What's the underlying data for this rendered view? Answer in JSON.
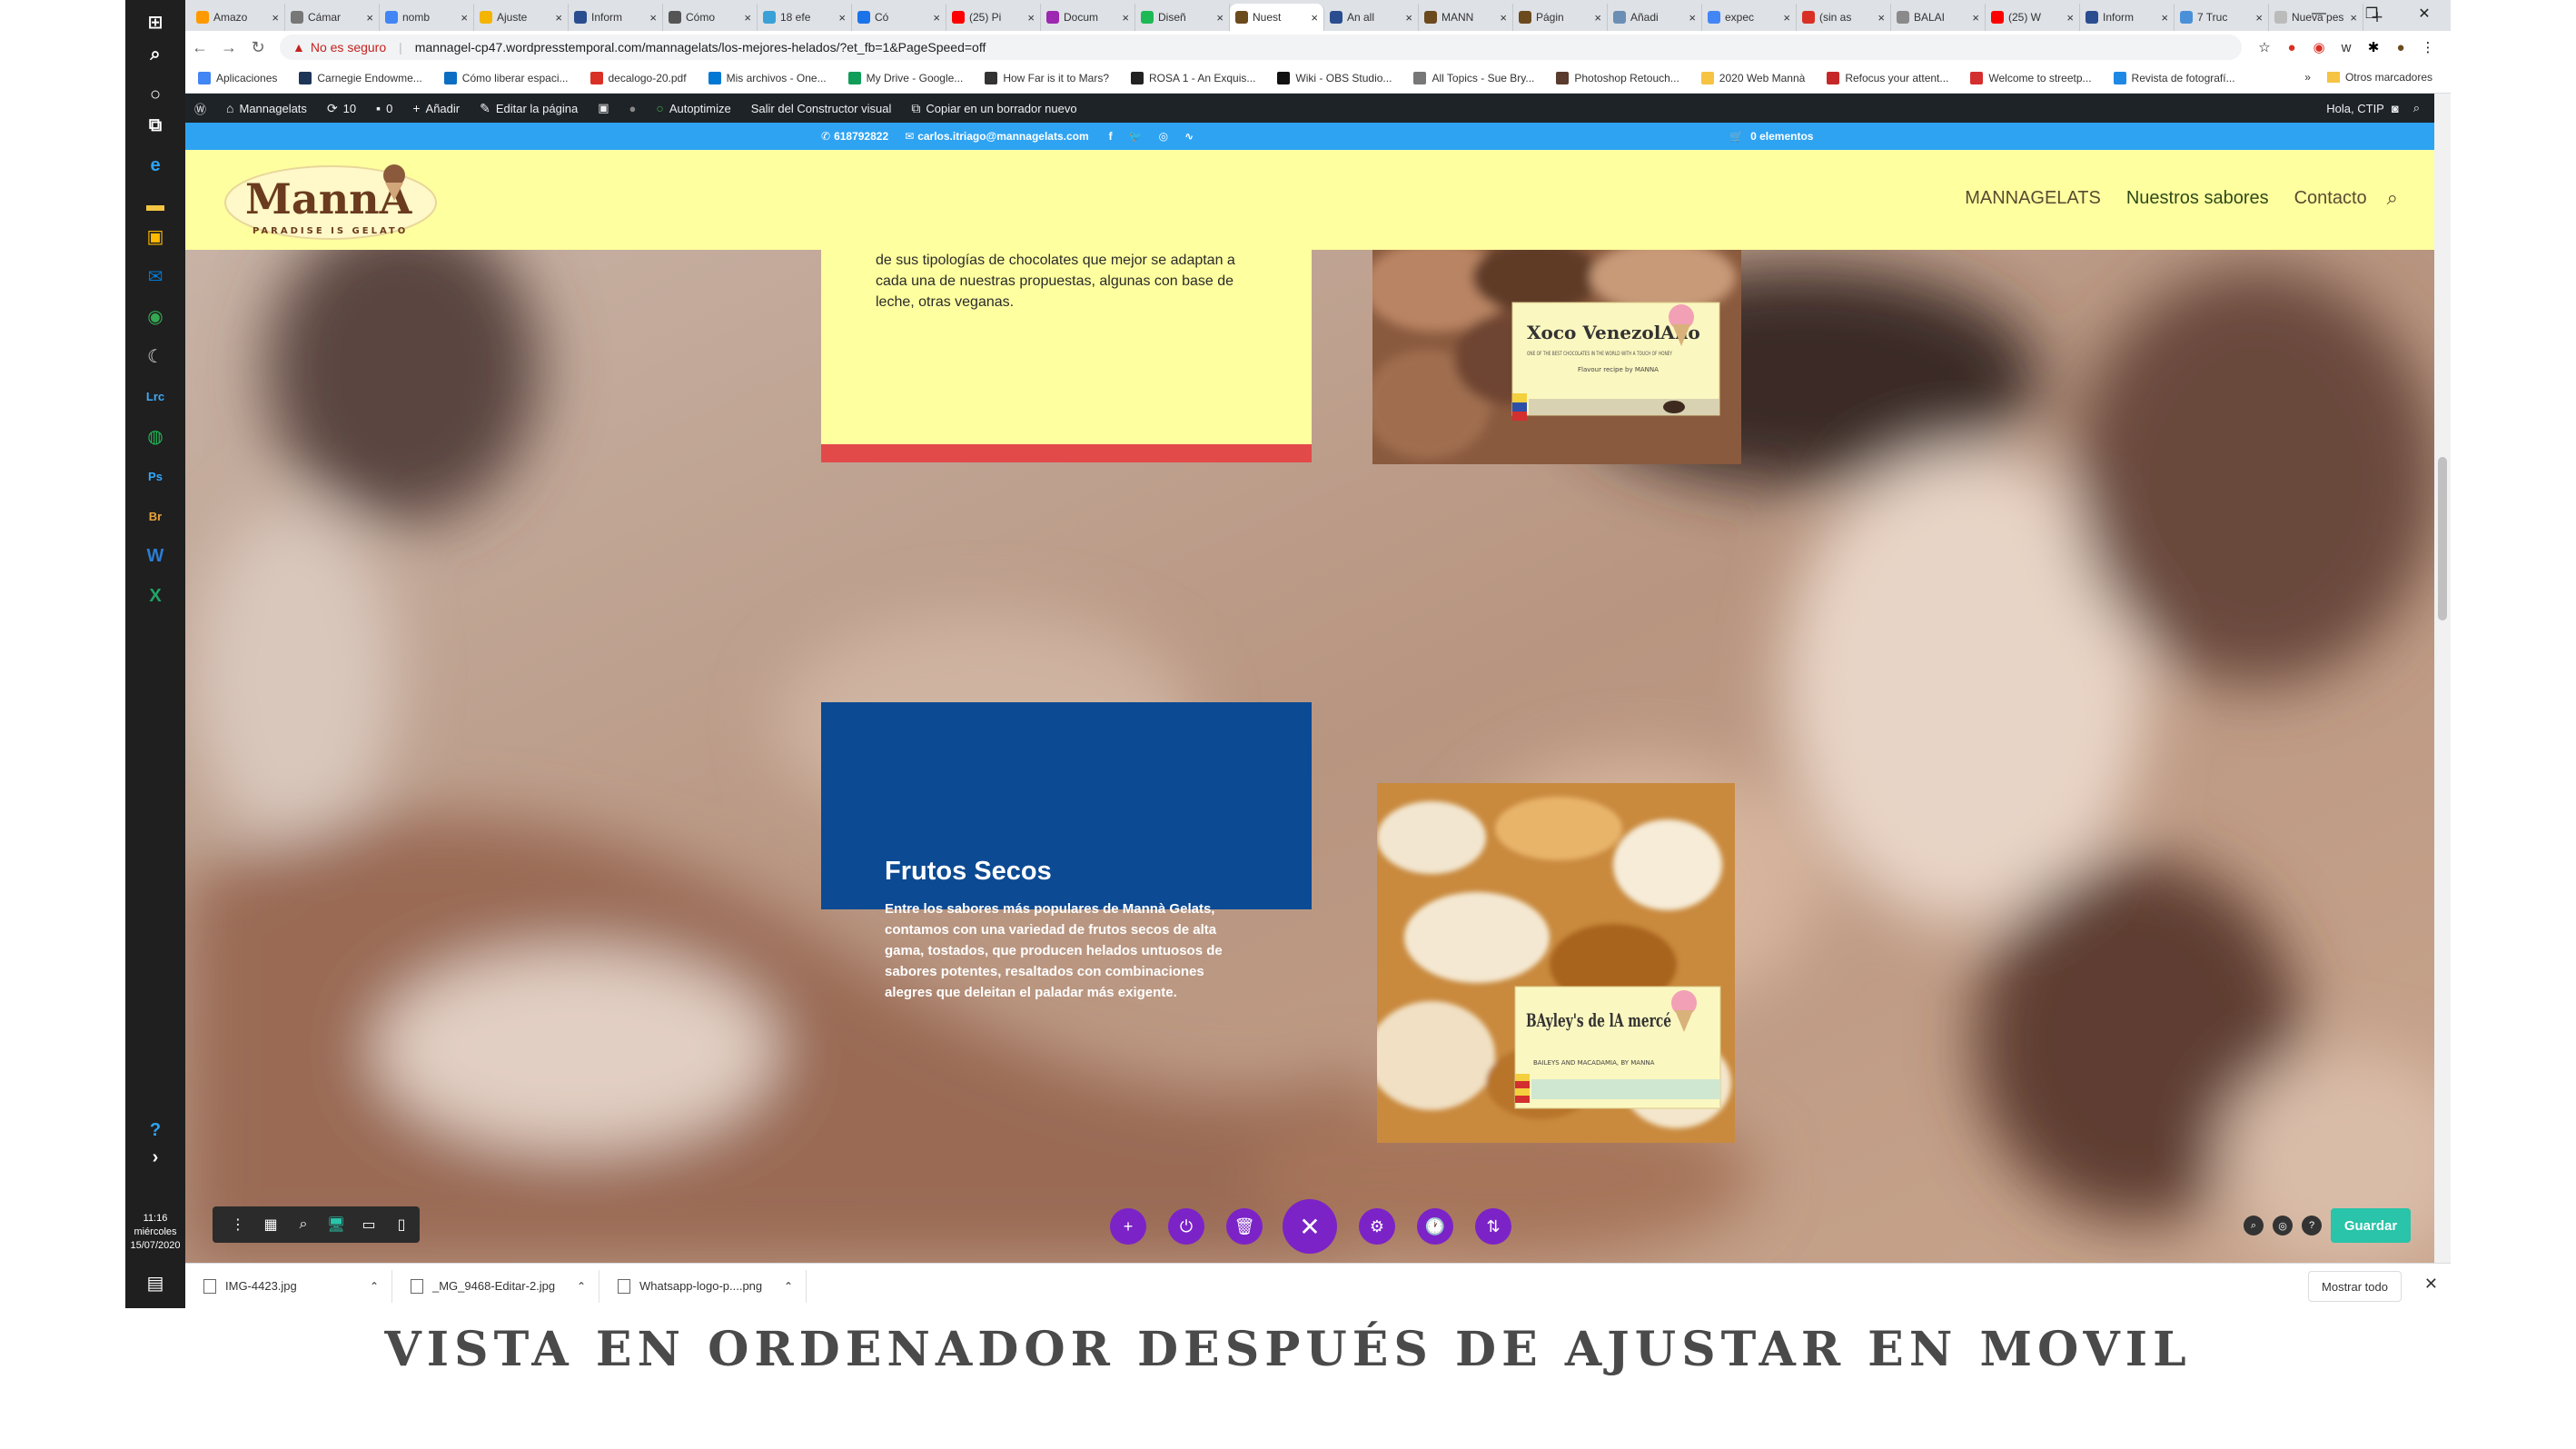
{
  "browser": {
    "tabs": [
      {
        "label": "Amazo",
        "color": "#ff9900"
      },
      {
        "label": "Cámar",
        "color": "#777777"
      },
      {
        "label": "nomb",
        "color": "#4285f4"
      },
      {
        "label": "Ajuste",
        "color": "#f4b400"
      },
      {
        "label": "Inform",
        "color": "#2a4d8f"
      },
      {
        "label": "Cómo",
        "color": "#555555"
      },
      {
        "label": "18 efe",
        "color": "#3aa0d8"
      },
      {
        "label": "Có",
        "color": "#1a73e8"
      },
      {
        "label": "(25) Pi",
        "color": "#ff0000"
      },
      {
        "label": "Docum",
        "color": "#9c27b0"
      },
      {
        "label": "Diseñ",
        "color": "#1db954"
      },
      {
        "label": "Nuest",
        "color": "#6b4a1e"
      },
      {
        "label": "An all",
        "color": "#2a4d8f"
      },
      {
        "label": "MANN",
        "color": "#6b4a1e"
      },
      {
        "label": "Págin",
        "color": "#6b4a1e"
      },
      {
        "label": "Añadi",
        "color": "#6b8fb4"
      },
      {
        "label": "expec",
        "color": "#4285f4"
      },
      {
        "label": "(sin as",
        "color": "#d93025"
      },
      {
        "label": "BALAI",
        "color": "#8a8a8a"
      },
      {
        "label": "(25) W",
        "color": "#ff0000"
      },
      {
        "label": "Inform",
        "color": "#2a4d8f"
      },
      {
        "label": "7 Truc",
        "color": "#4a90d9"
      },
      {
        "label": "Nueva pes",
        "color": "#bbbbbb"
      }
    ],
    "active_tab_index": 11,
    "new_tab": "+",
    "window_controls": [
      "—",
      "❐",
      "✕"
    ],
    "security_label": "No es seguro",
    "url": "mannagel-cp47.wordpresstemporal.com/mannagelats/los-mejores-helados/?et_fb=1&PageSpeed=off",
    "bookmarks": [
      {
        "label": "Aplicaciones",
        "color": "#4285f4"
      },
      {
        "label": "Carnegie Endowme...",
        "color": "#1d3557"
      },
      {
        "label": "Cómo liberar espaci...",
        "color": "#0b6ec2"
      },
      {
        "label": "decalogo-20.pdf",
        "color": "#d93025"
      },
      {
        "label": "Mis archivos - One...",
        "color": "#0078d4"
      },
      {
        "label": "My Drive - Google...",
        "color": "#0f9d58"
      },
      {
        "label": "How Far is it to Mars?",
        "color": "#333333"
      },
      {
        "label": "ROSA 1 - An Exquis...",
        "color": "#222222"
      },
      {
        "label": "Wiki - OBS Studio...",
        "color": "#111111"
      },
      {
        "label": "All Topics - Sue Bry...",
        "color": "#777777"
      },
      {
        "label": "Photoshop Retouch...",
        "color": "#5a3b2e"
      },
      {
        "label": "2020 Web Mannà",
        "color": "#f6c342"
      },
      {
        "label": "Refocus your attent...",
        "color": "#c62828"
      },
      {
        "label": "Welcome to streetp...",
        "color": "#d32f2f"
      },
      {
        "label": "Revista de fotografí...",
        "color": "#1e88e5"
      }
    ],
    "bookmarks_more": "»",
    "other_bookmarks": "Otros marcadores"
  },
  "wpbar": {
    "site_name": "Mannagelats",
    "updates": "10",
    "comments": "0",
    "add_new": "Añadir",
    "edit_page": "Editar la página",
    "autoptimize": "Autoptimize",
    "exit_builder": "Salir del Constructor visual",
    "copy_draft": "Copiar en un borrador nuevo",
    "greeting": "Hola, CTIP"
  },
  "site": {
    "phone": "618792822",
    "email": "carlos.itriago@mannagelats.com",
    "cart": "0 elementos",
    "logo_text": "MannA",
    "logo_tagline": "PARADISE IS GELATO",
    "nav": [
      "MANNAGELATS",
      "Nuestros sabores",
      "Contacto"
    ],
    "yellow_card_text": "de sus tipologías de chocolates que mejor se adaptan a cada una de nuestras propuestas, algunas con base de leche, otras veganas.",
    "card1_label_title": "Xoco VenezolAno",
    "card1_label_sub": "ONE OF THE BEST CHOCOLATES IN THE WORLD WITH A TOUCH OF HONEY",
    "card1_label_sig": "Flavour recipe by MANNA",
    "frutos_title": "Frutos Secos",
    "frutos_text": "Entre los sabores más populares de Mannà Gelats, contamos con una variedad de frutos secos de alta gama, tostados, que producen helados untuosos de sabores potentes, resaltados con combinaciones alegres que deleitan el paladar más exigente.",
    "card2_label_title": "BAyley's de lA mercé",
    "card2_label_sub": "BAILEYS AND MACADAMIA, BY MANNA"
  },
  "builder": {
    "left_tools": [
      "⋮",
      "▦",
      "⌕",
      "🖥",
      "▭",
      "▯"
    ],
    "center_buttons": [
      "+",
      "⏻",
      "🗑",
      "✕",
      "⚙",
      "🕐",
      "⇅"
    ],
    "right_tools": [
      "⌕",
      "◎",
      "?"
    ],
    "save_label": "Guardar"
  },
  "taskbar": {
    "icons": [
      {
        "glyph": "⊞",
        "color": "#ffffff"
      },
      {
        "glyph": "⌕",
        "color": "#ffffff"
      },
      {
        "glyph": "○",
        "color": "#ffffff"
      },
      {
        "glyph": "⧉",
        "color": "#ffffff"
      },
      {
        "glyph": "e",
        "color": "#2ea3f2"
      },
      {
        "glyph": "▬",
        "color": "#f4c542"
      },
      {
        "glyph": "▣",
        "color": "#ffb900"
      },
      {
        "glyph": "✉",
        "color": "#0078d4"
      },
      {
        "glyph": "◉",
        "color": "#34a853"
      },
      {
        "glyph": "☾",
        "color": "#dddddd"
      },
      {
        "glyph": "Lrc",
        "color": "#3fa9f5"
      },
      {
        "glyph": "◍",
        "color": "#1db954"
      },
      {
        "glyph": "Ps",
        "color": "#31a8ff"
      },
      {
        "glyph": "Br",
        "color": "#e8a33d"
      },
      {
        "glyph": "W",
        "color": "#2b7cd3"
      },
      {
        "glyph": "X",
        "color": "#21a366"
      }
    ],
    "time": "11:16",
    "day": "miércoles",
    "date": "15/07/2020"
  },
  "downloads": [
    {
      "name": "IMG-4423.jpg"
    },
    {
      "name": "_MG_9468-Editar-2.jpg"
    },
    {
      "name": "Whatsapp-logo-p....png"
    }
  ],
  "downloads_show_all": "Mostrar todo",
  "caption": "VISTA EN ORDENADOR DESPUÉS DE AJUSTAR EN MOVIL"
}
